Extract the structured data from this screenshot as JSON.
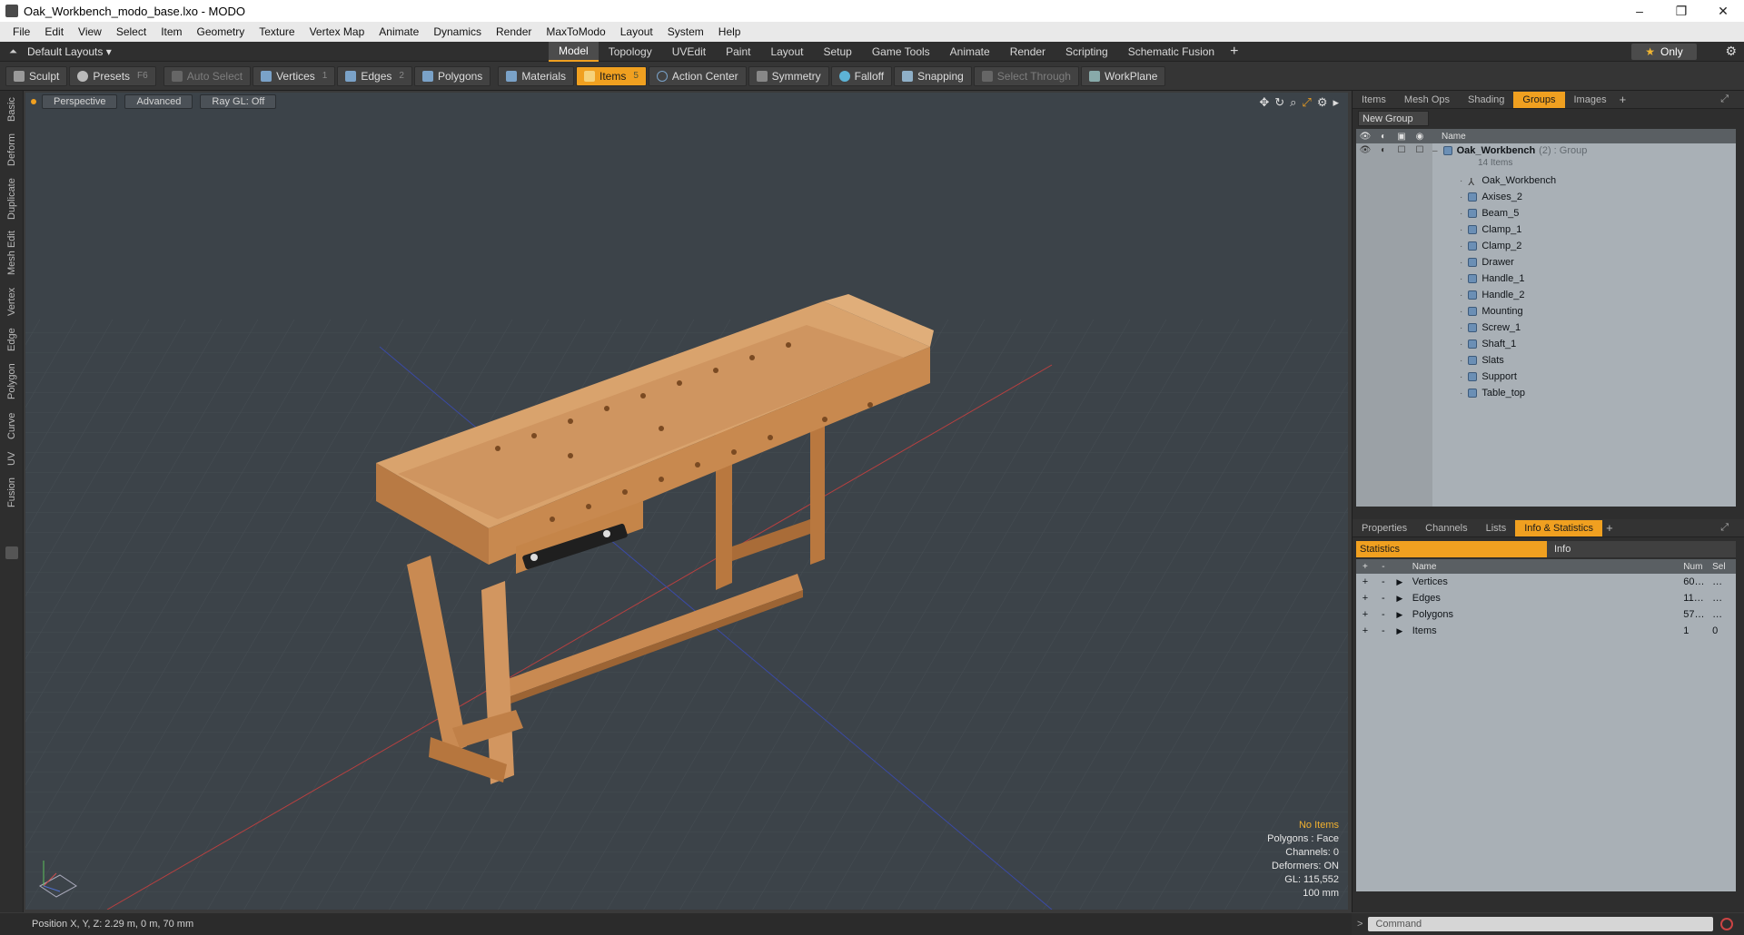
{
  "window": {
    "title": "Oak_Workbench_modo_base.lxo - MODO",
    "controls": [
      "–",
      "❐",
      "✕"
    ]
  },
  "menu": [
    "File",
    "Edit",
    "View",
    "Select",
    "Item",
    "Geometry",
    "Texture",
    "Vertex Map",
    "Animate",
    "Dynamics",
    "Render",
    "MaxToModo",
    "Layout",
    "System",
    "Help"
  ],
  "layoutbar": {
    "layouts_label": "Default Layouts ▾",
    "tabs": [
      "Model",
      "Topology",
      "UVEdit",
      "Paint",
      "Layout",
      "Setup",
      "Game Tools",
      "Animate",
      "Render",
      "Scripting",
      "Schematic Fusion"
    ],
    "active_tab": "Model",
    "plus": "+",
    "only_label": "Only",
    "only_star": "★"
  },
  "toolbar": {
    "sculpt": "Sculpt",
    "presets": "Presets",
    "presets_key": "F6",
    "auto_select": "Auto Select",
    "vertices": "Vertices",
    "vertices_key": "1",
    "edges": "Edges",
    "edges_key": "2",
    "polygons": "Polygons",
    "materials": "Materials",
    "items": "Items",
    "items_key": "5",
    "action_center": "Action Center",
    "symmetry": "Symmetry",
    "falloff": "Falloff",
    "snapping": "Snapping",
    "select_through": "Select Through",
    "workplane": "WorkPlane"
  },
  "left_tabs": [
    "Basic",
    "Deform",
    "Duplicate",
    "Mesh Edit",
    "Vertex",
    "Edge",
    "Polygon",
    "Curve",
    "UV",
    "Fusion"
  ],
  "viewport": {
    "view": "Perspective",
    "shading": "Advanced",
    "raygl": "Ray GL: Off",
    "stats": {
      "no_items": "No Items",
      "polygons": "Polygons : Face",
      "channels": "Channels: 0",
      "deformers": "Deformers: ON",
      "gl": "GL: 115,552",
      "scale": "100 mm"
    }
  },
  "groups_panel": {
    "tabs": [
      "Items",
      "Mesh Ops",
      "Shading",
      "Groups",
      "Images"
    ],
    "active_tab": "Groups",
    "new_group": "New Group",
    "name_header": "Name",
    "group": {
      "name": "Oak_Workbench",
      "meta": "(2) : Group",
      "count": "14 Items"
    },
    "items": [
      "Oak_Workbench",
      "Axises_2",
      "Beam_5",
      "Clamp_1",
      "Clamp_2",
      "Drawer",
      "Handle_1",
      "Handle_2",
      "Mounting",
      "Screw_1",
      "Shaft_1",
      "Slats",
      "Support",
      "Table_top"
    ]
  },
  "stats_panel": {
    "tabs": [
      "Properties",
      "Channels",
      "Lists",
      "Info & Statistics"
    ],
    "active_tab": "Info & Statistics",
    "sub_tabs": [
      "Statistics",
      "Info"
    ],
    "headers": {
      "name": "Name",
      "num": "Num",
      "sel": "Sel"
    },
    "rows": [
      {
        "name": "Vertices",
        "num": "60…",
        "sel": "…"
      },
      {
        "name": "Edges",
        "num": "11…",
        "sel": "…"
      },
      {
        "name": "Polygons",
        "num": "57…",
        "sel": "…"
      },
      {
        "name": "Items",
        "num": "1",
        "sel": "0"
      }
    ]
  },
  "status": {
    "position": "Position X, Y, Z:   2.29 m, 0 m, 70 mm"
  },
  "command": {
    "placeholder": "Command",
    "caret": ">"
  },
  "colors": {
    "accent": "#f0a020",
    "wood": "#c98a52",
    "viewport_bg": "#3c4349",
    "panel_table": "#a9b0b6"
  }
}
